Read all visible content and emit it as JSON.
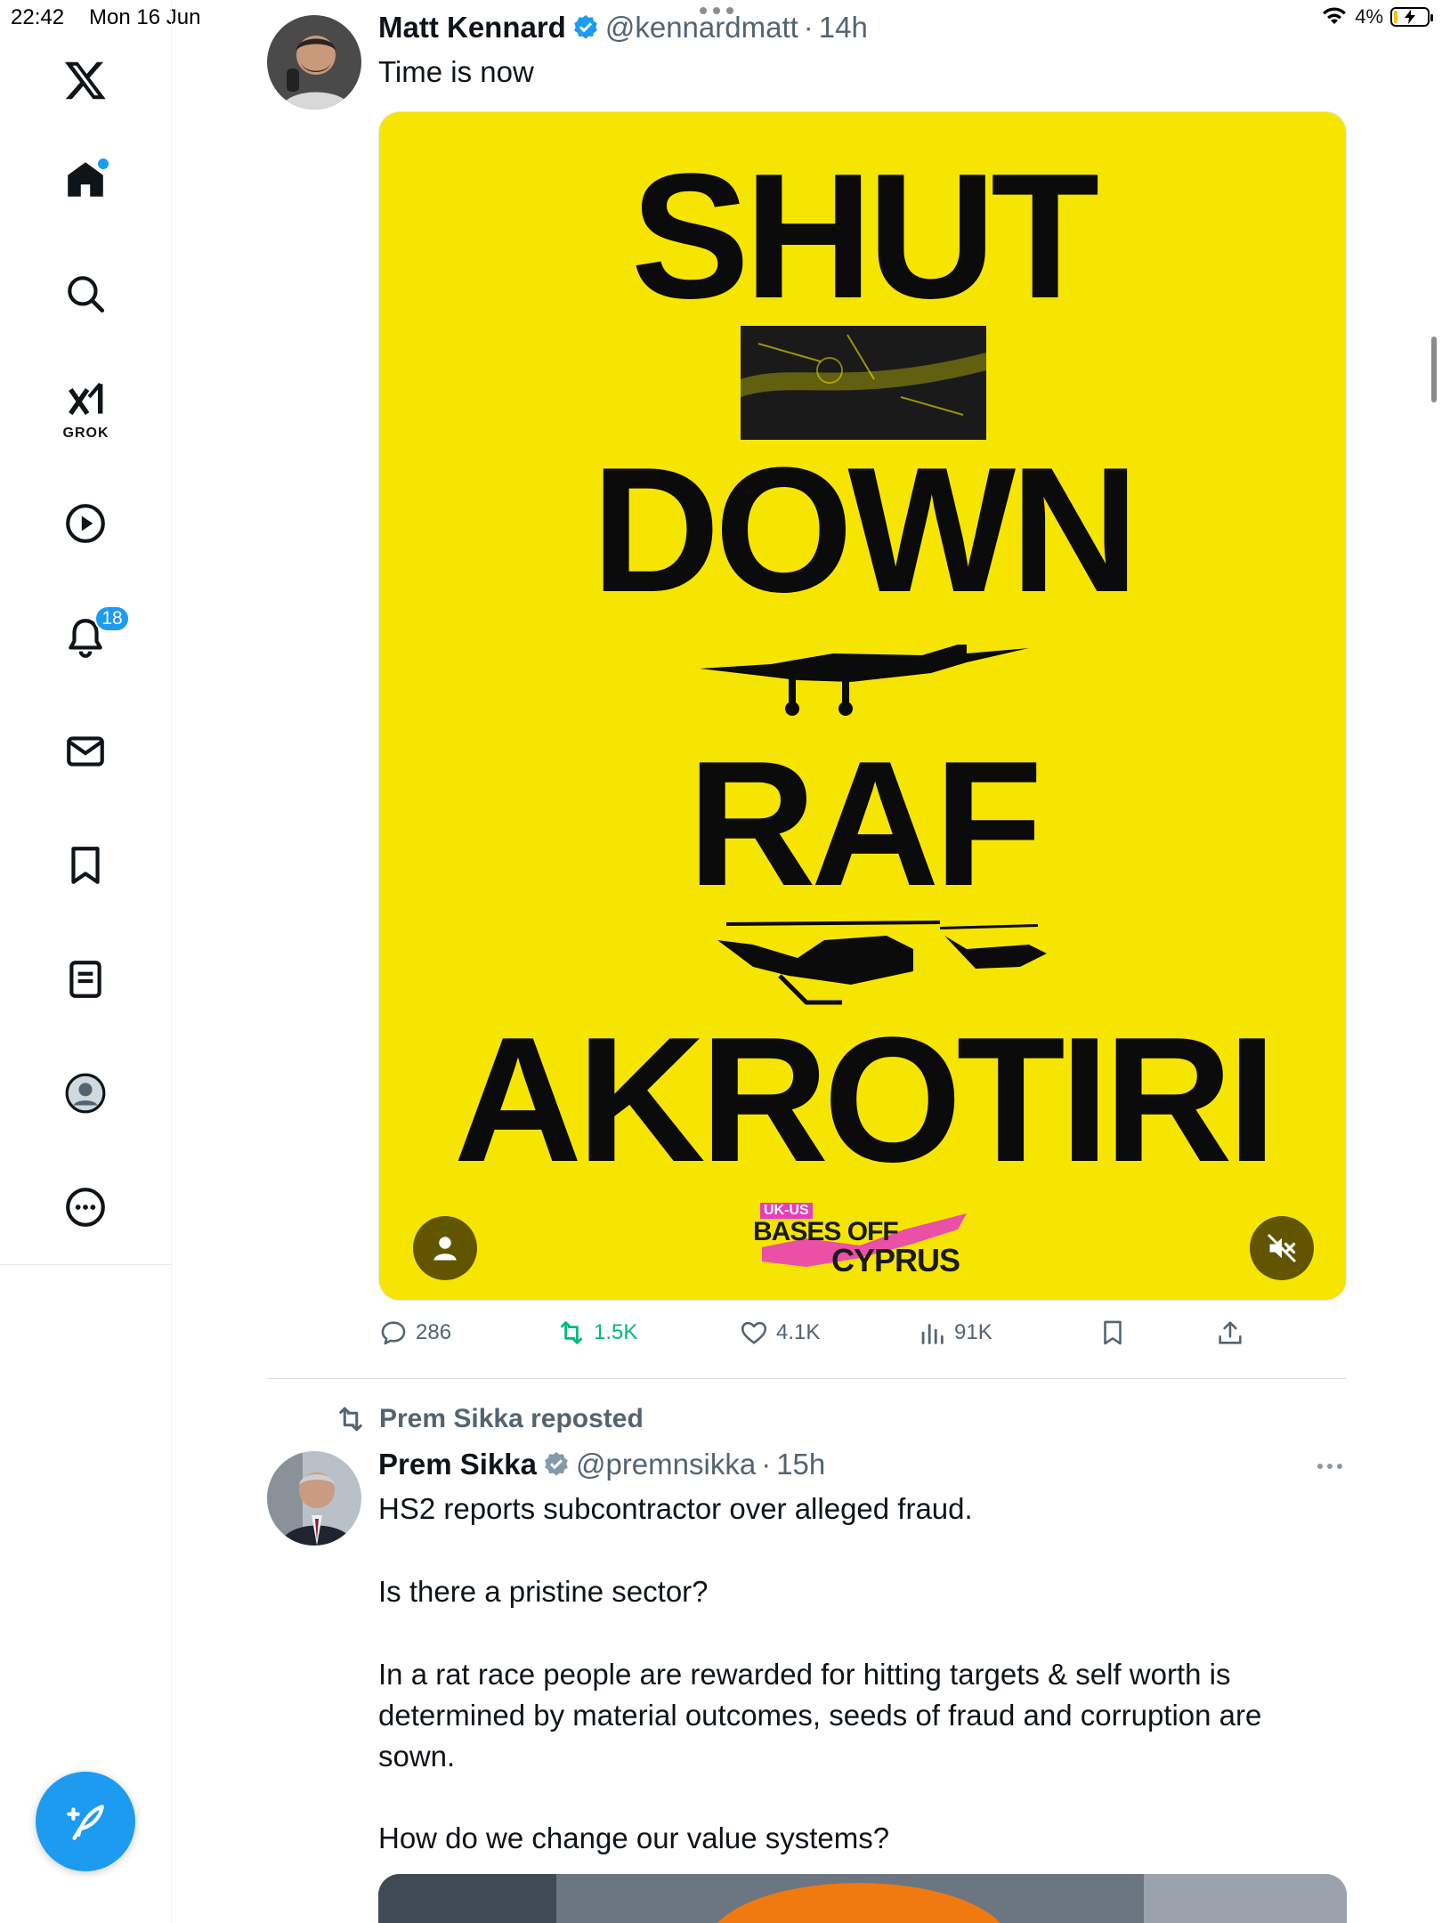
{
  "status_bar": {
    "time": "22:42",
    "date": "Mon 16 Jun",
    "battery": "4%"
  },
  "sidebar": {
    "items": [
      {
        "name": "x-logo-icon"
      },
      {
        "name": "home-icon",
        "has_dot": true
      },
      {
        "name": "search-icon"
      },
      {
        "name": "grok-icon",
        "label": "GROK"
      },
      {
        "name": "video-icon"
      },
      {
        "name": "notifications-icon",
        "badge": "18"
      },
      {
        "name": "messages-icon"
      },
      {
        "name": "bookmarks-icon"
      },
      {
        "name": "lists-icon"
      },
      {
        "name": "profile-icon"
      },
      {
        "name": "more-icon"
      }
    ],
    "compose_icon": "compose-icon"
  },
  "tweet1": {
    "name": "Matt Kennard",
    "handle": "@kennardmatt",
    "separator": "·",
    "time": "14h",
    "text": "Time is now",
    "poster": {
      "lines": [
        "SHUT",
        "DOWN",
        "RAF",
        "AKROTIRI"
      ],
      "logo_top": "UK-US",
      "logo_mid": "BASES OFF",
      "logo_bottom": "CYPRUS"
    },
    "actions": {
      "replies": "286",
      "reposts": "1.5K",
      "likes": "4.1K",
      "views": "91K"
    }
  },
  "tweet2": {
    "repost_label": "Prem Sikka reposted",
    "name": "Prem Sikka",
    "handle": "@premnsikka",
    "separator": "·",
    "time": "15h",
    "paragraphs": [
      "HS2 reports subcontractor over alleged fraud.",
      "Is there a pristine sector?",
      "In a rat race people are rewarded for hitting targets & self worth is determined by material outcomes, seeds of fraud and corruption are sown.",
      "How do we change our value systems?"
    ]
  },
  "colors": {
    "accent": "#1d9bf0",
    "repost_green": "#00ba7c",
    "poster_yellow": "#f6e500",
    "logo_pink": "#e83fb8"
  }
}
